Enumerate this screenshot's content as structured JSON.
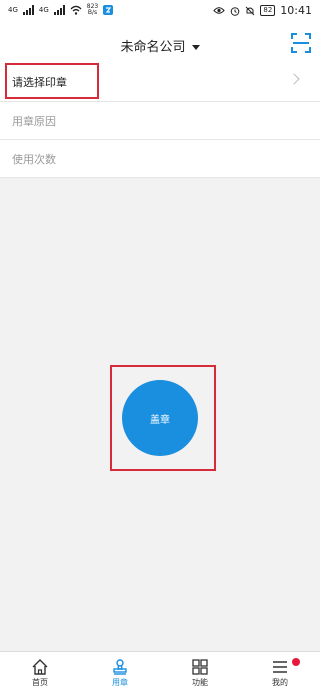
{
  "status_bar": {
    "tag_4g": "4G",
    "net_speed_value": "823",
    "net_speed_unit": "B/s",
    "battery": "82",
    "time": "10:41"
  },
  "header": {
    "company_name": "未命名公司"
  },
  "form": {
    "select_seal": "请选择印章",
    "reason_placeholder": "用章原因",
    "count_placeholder": "使用次数"
  },
  "stamp_button": {
    "label": "盖章"
  },
  "tabbar": {
    "items": [
      {
        "label": "首页",
        "icon": "home-icon"
      },
      {
        "label": "用章",
        "icon": "stamp-icon"
      },
      {
        "label": "功能",
        "icon": "grid-icon"
      },
      {
        "label": "我的",
        "icon": "menu-icon"
      }
    ],
    "active_index": 1
  },
  "colors": {
    "accent": "#1a8fe0",
    "highlight": "#d62b38",
    "badge": "#e8173c"
  }
}
